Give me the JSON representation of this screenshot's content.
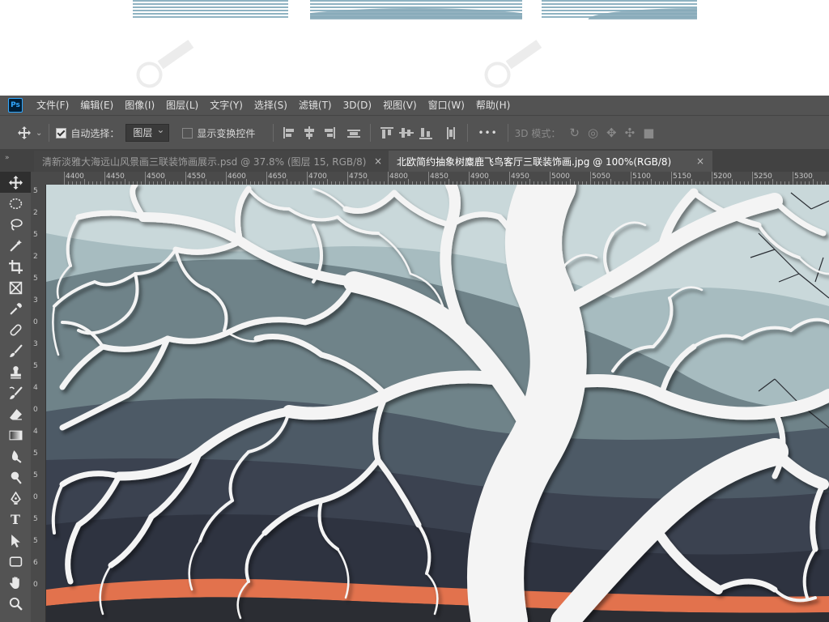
{
  "menu": {
    "app_icon": "Ps",
    "items": [
      "文件(F)",
      "编辑(E)",
      "图像(I)",
      "图层(L)",
      "文字(Y)",
      "选择(S)",
      "滤镜(T)",
      "3D(D)",
      "视图(V)",
      "窗口(W)",
      "帮助(H)"
    ]
  },
  "options": {
    "auto_select_label": "自动选择：",
    "auto_select_checked": true,
    "layer_select_value": "图层",
    "show_transform_label": "显示变换控件",
    "show_transform_checked": false,
    "more": "•••",
    "mode_3d_label": "3D 模式："
  },
  "tabs": [
    {
      "title": "清新淡雅大海远山风景画三联装饰画展示.psd @ 37.8% (图层 15, RGB/8)",
      "close": "×",
      "active": false
    },
    {
      "title": "北欧简约抽象树麋鹿飞鸟客厅三联装饰画.jpg @ 100%(RGB/8)",
      "close": "×",
      "active": true
    }
  ],
  "ruler": {
    "top_labels": [
      "4400",
      "4450",
      "4500",
      "4550",
      "4600",
      "4650",
      "4700",
      "4750",
      "4800",
      "4850",
      "4900",
      "4950",
      "5000",
      "5050",
      "5100",
      "5150",
      "5200",
      "5250",
      "5300"
    ],
    "left_labels": [
      "5",
      "2",
      "5",
      "2",
      "5",
      "3",
      "0",
      "3",
      "5",
      "4",
      "0",
      "4",
      "5",
      "5",
      "0",
      "5",
      "5",
      "6",
      "0"
    ]
  },
  "tools": [
    {
      "name": "move-tool",
      "icon": "move-icon",
      "selected": true
    },
    {
      "name": "marquee-tool",
      "icon": "ellipse-marquee-icon"
    },
    {
      "name": "lasso-tool",
      "icon": "lasso-icon"
    },
    {
      "name": "quick-select-tool",
      "icon": "magic-wand-icon"
    },
    {
      "name": "crop-tool",
      "icon": "crop-icon"
    },
    {
      "name": "frame-tool",
      "icon": "frame-icon"
    },
    {
      "name": "eyedropper-tool",
      "icon": "eyedropper-icon"
    },
    {
      "name": "healing-tool",
      "icon": "bandage-icon"
    },
    {
      "name": "brush-tool",
      "icon": "brush-icon"
    },
    {
      "name": "stamp-tool",
      "icon": "stamp-icon"
    },
    {
      "name": "history-brush-tool",
      "icon": "history-brush-icon"
    },
    {
      "name": "eraser-tool",
      "icon": "eraser-icon"
    },
    {
      "name": "gradient-tool",
      "icon": "gradient-icon"
    },
    {
      "name": "blur-tool",
      "icon": "blur-drop-icon"
    },
    {
      "name": "dodge-tool",
      "icon": "dodge-icon"
    },
    {
      "name": "pen-tool",
      "icon": "pen-icon"
    },
    {
      "name": "type-tool",
      "icon": "type-icon",
      "glyph": "T"
    },
    {
      "name": "path-select-tool",
      "icon": "arrow-select-icon"
    },
    {
      "name": "shape-tool",
      "icon": "rectangle-icon"
    },
    {
      "name": "hand-tool",
      "icon": "hand-icon"
    },
    {
      "name": "zoom-tool",
      "icon": "zoom-icon"
    }
  ],
  "colors": {
    "panel": "#535353",
    "sky": "#9fb4b8",
    "hill_dark": "#3b3f47",
    "orange_band": "#e2724d",
    "branch": "#f4f4f4"
  }
}
